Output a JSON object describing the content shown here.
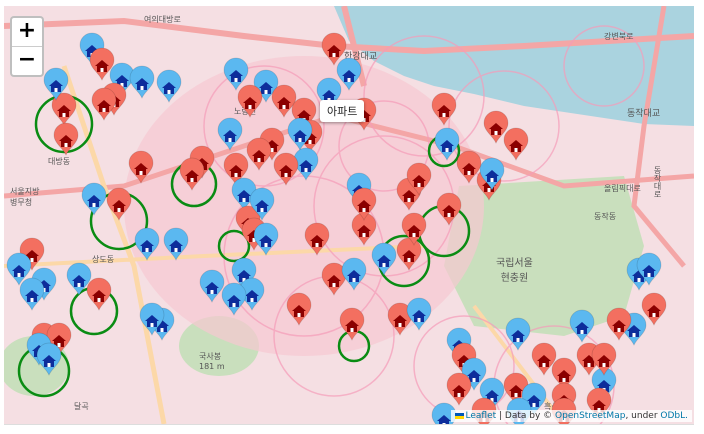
{
  "map": {
    "zoom_in": "+",
    "zoom_out": "−",
    "tooltip": "아파트",
    "attribution": {
      "leaflet": "Leaflet",
      "sep1": " | Data by © ",
      "osm": "OpenStreetMap",
      "sep2": ", under ",
      "odbl": "ODbL."
    },
    "labels": {
      "hangang_bridge": "한강대교",
      "dongjak_bridge": "동작대교",
      "national_cemetery": "국립서울\n현충원",
      "dongjak_dong": "동작동",
      "daebang_dong": "대방동",
      "seoul_bureau": "서울지방\n병무청",
      "sangdo_dong": "상도동",
      "noryangjin": "노량진",
      "heukseok": "흑석",
      "dangok": "달곡",
      "gukabsan": "국사봉\n181 m",
      "yeouido_ro": "여의대방로",
      "olympic": "올림픽대로",
      "gangbyeon": "강변북로",
      "dongjak_ro": "동작대로"
    },
    "colors": {
      "water": "#aad3df",
      "residential": "#f7c7d2",
      "park": "#c9dfbd",
      "road": "#f4a6a6",
      "blue_marker": "#5bb8f0",
      "red_marker": "#f36f60",
      "house_blue": "#0d2d9b",
      "house_red": "#8b0000",
      "circle_green": "#0a8c13",
      "circle_pink": "#f59cb9"
    }
  }
}
